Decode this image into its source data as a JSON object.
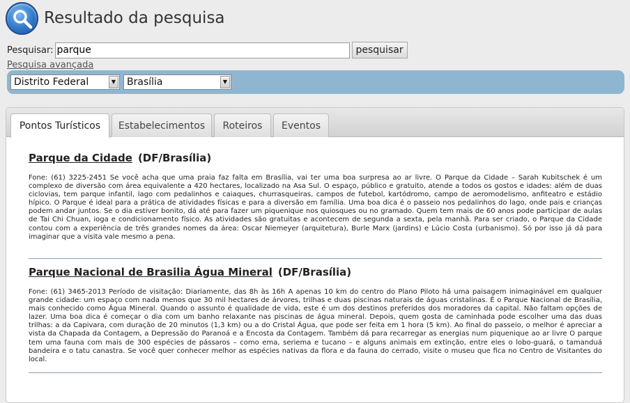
{
  "header": {
    "title": "Resultado da pesquisa",
    "logo_icon": "magnifier-icon"
  },
  "search": {
    "label": "Pesquisar:",
    "value": "parque",
    "button_label": "pesquisar",
    "advanced_link": "Pesquisa avançada"
  },
  "filters": {
    "state": "Distrito Federal",
    "city": "Brasília"
  },
  "tabs": [
    {
      "label": "Pontos Turísticos",
      "active": true
    },
    {
      "label": "Estabelecimentos"
    },
    {
      "label": "Roteiros"
    },
    {
      "label": "Eventos"
    }
  ],
  "results": [
    {
      "name": "Parque da Cidade",
      "location": "(DF/Brasília)",
      "description": "Fone: (61) 3225-2451 Se você acha que uma praia faz falta em Brasília, vai ter uma boa surpresa ao ar livre. O Parque da Cidade – Sarah Kubitschek é um complexo de diversão com área equivalente a 420 hectares, localizado na Asa Sul. O espaço, público e gratuito, atende a todos os gostos e idades: além de duas ciclovias, tem parque infantil, lago com pedalinhos e caiaques, churrasqueiras, campos de futebol, kartódromo, campo de aeromodelismo, anfiteatro e estádio hípico. O Parque é ideal para a prática de atividades físicas e para a diversão em família. Uma boa dica é o passeio nos pedalinhos do lago, onde pais e crianças podem andar juntos. Se o dia estiver bonito, dá até para fazer um piquenique nos quiosques ou no gramado. Quem tem mais de 60 anos pode participar de aulas de Tai Chi Chuan, ioga e condicionamento físico. As atividades são gratuitas e acontecem de segunda a sexta, pela manhã. Para ser criado, o Parque da Cidade contou com a experiência de três grandes nomes da área: Oscar Niemeyer (arquitetura), Burle Marx (jardins) e Lúcio Costa (urbanismo). Só por isso já dá para imaginar que a visita vale mesmo a pena."
    },
    {
      "name": "Parque Nacional de Brasilia Água Mineral",
      "location": "(DF/Brasília)",
      "description": "Fone: (61) 3465-2013 Período de visitação: Diariamente, das 8h às 16h A apenas 10 km do centro do Plano Piloto há uma paisagem inimaginável em qualquer grande cidade: um espaço com nada menos que 30 mil hectares de árvores, trilhas e duas piscinas naturais de águas cristalinas. É o Parque Nacional de Brasília, mais conhecido como Água Mineral. Quando o assunto é qualidade de vida, este é um dos destinos preferidos dos moradores da capital. Não faltam opções de lazer. Uma boa dica é começar o dia com um banho relaxante nas piscinas de água mineral. Depois, quem gosta de caminhada pode escolher uma das duas trilhas: a da Capivara, com duração de 20 minutos (1,3 km) ou a do Cristal Água, que pode ser feita em 1 hora (5 km). Ao final do passeio, o melhor é apreciar a vista da Chapada da Contagem, a Depressão do Paranoá e a Encosta da Contagem. Também dá para recarregar as energias num piquenique ao ar livre O parque tem uma fauna com mais de 300 espécies de pássaros – como ema, seriema e tucano – e alguns animais em extinção, entre eles o lobo-guará, o tamanduá bandeira e o tatu canastra. Se você quer conhecer melhor as espécies nativas da flora e da fauna do cerrado, visite o museu que fica no Centro de Visitantes do local."
    }
  ]
}
